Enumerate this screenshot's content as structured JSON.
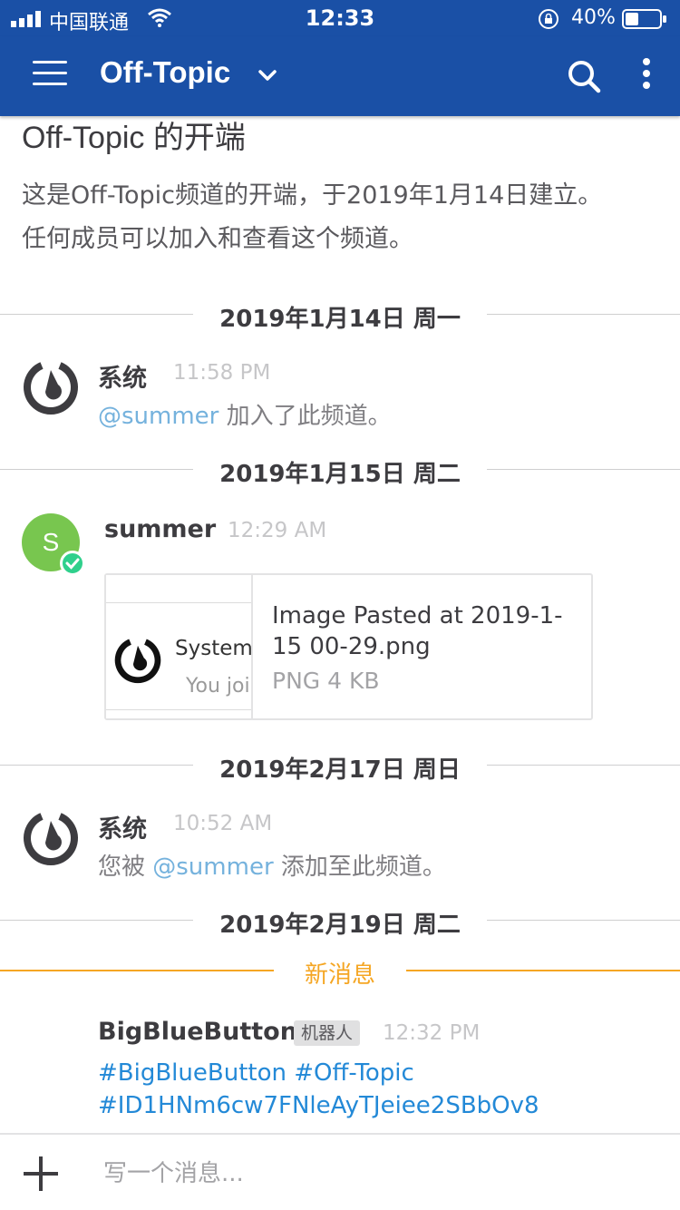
{
  "status_bar": {
    "carrier": "中国联通",
    "time": "12:33",
    "battery_percent": "40%",
    "battery_level": 0.4
  },
  "header": {
    "channel_name": "Off-Topic"
  },
  "intro": {
    "title": "Off-Topic 的开端",
    "line1": "这是Off-Topic频道的开端，于2019年1月14日建立。",
    "line2": "任何成员可以加入和查看这个频道。"
  },
  "date_separators": [
    "2019年1月14日 周一",
    "2019年1月15日 周二",
    "2019年2月17日 周日",
    "2019年2月19日 周二"
  ],
  "posts": [
    {
      "author": "系统",
      "time": "11:58 PM",
      "mention": "@summer",
      "text": " 加入了此频道。"
    },
    {
      "author": "summer",
      "avatar_letter": "S",
      "time": "12:29 AM",
      "attachment": {
        "thumb_title": "System",
        "thumb_sub": "You joi",
        "name": "Image Pasted at 2019-1-15 00-29.png",
        "meta": "PNG 4 KB"
      }
    },
    {
      "author": "系统",
      "time": "10:52 AM",
      "prefix": "您被 ",
      "mention": "@summer",
      "text": " 添加至此频道。"
    },
    {
      "author": "BigBlueButton",
      "badge": "机器人",
      "time": "12:32 PM",
      "hashtags_line1": "#BigBlueButton #Off-Topic",
      "hashtags_line2": "#ID1HNm6cw7FNleAyTJeiee2SBbOv8"
    }
  ],
  "new_messages_label": "新消息",
  "composer": {
    "placeholder": "写一个消息..."
  },
  "colors": {
    "header": "#1a50a6",
    "mention": "#75b2dd",
    "link": "#2389d7",
    "new_messages": "#f5a623",
    "avatar_green": "#78c64f",
    "online": "#2fd08c"
  }
}
